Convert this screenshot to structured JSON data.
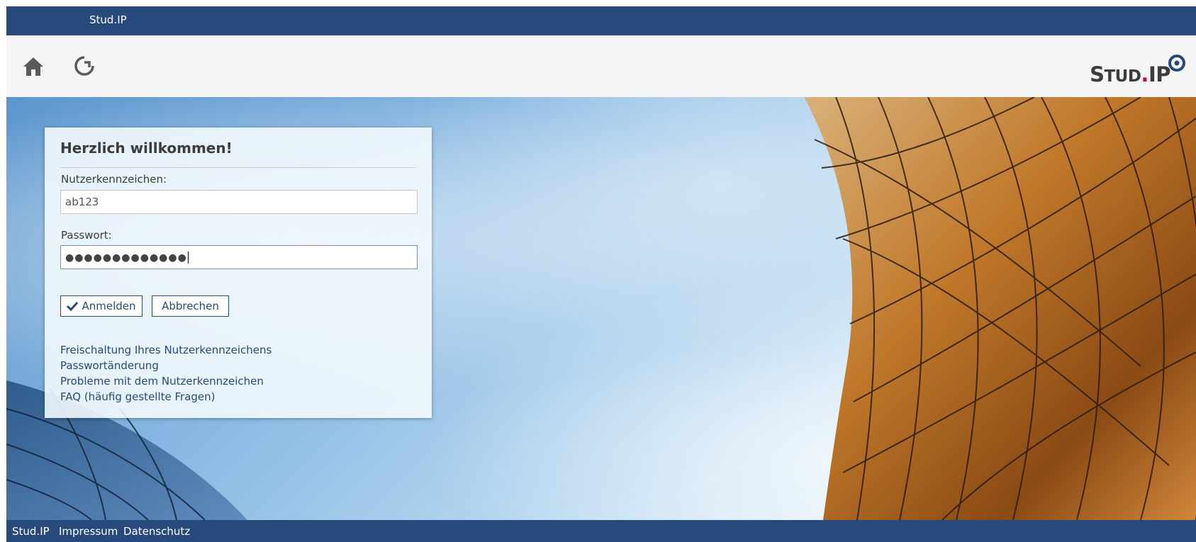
{
  "topbar": {
    "brand": "Stud.IP"
  },
  "header": {
    "home_icon": "home-icon",
    "rotate_icon": "rotate-icon",
    "logo": {
      "part1": "S",
      "part2": "TUD",
      "dot": ".",
      "part3": "IP"
    }
  },
  "login": {
    "title": "Herzlich willkommen!",
    "username_label": "Nutzerkennzeichen:",
    "username_value": "ab123",
    "password_label": "Passwort:",
    "password_dots": "●●●●●●●●●●●●●",
    "login_button": "Anmelden",
    "cancel_button": "Abbrechen",
    "links": [
      "Freischaltung Ihres Nutzerkennzeichens",
      "Passwortänderung",
      "Probleme mit dem Nutzerkennzeichen",
      "FAQ (häufig gestellte Fragen)"
    ]
  },
  "footer": {
    "links": [
      "Stud.IP",
      "Impressum",
      "Datenschutz"
    ]
  },
  "colors": {
    "brand_blue": "#28497c",
    "logo_dot": "#c8102e"
  }
}
